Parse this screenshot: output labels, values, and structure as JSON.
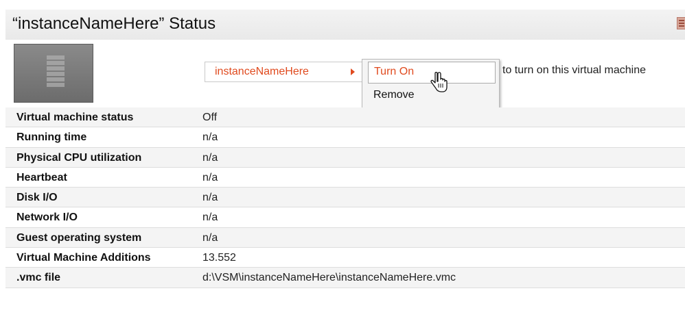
{
  "header": {
    "title": "“instanceNameHere” Status",
    "icon": "report-icon"
  },
  "vm": {
    "thumbnail_icon": "server-stack-icon",
    "menu_trigger_label": "instanceNameHere",
    "hint_text": "to turn on this virtual machine",
    "context_menu": {
      "items": [
        {
          "label": "Turn On"
        },
        {
          "label": "Remove"
        }
      ]
    }
  },
  "properties": [
    {
      "label": "Virtual machine status",
      "value": "Off"
    },
    {
      "label": "Running time",
      "value": "n/a"
    },
    {
      "label": "Physical CPU utilization",
      "value": "n/a"
    },
    {
      "label": "Heartbeat",
      "value": "n/a"
    },
    {
      "label": "Disk I/O",
      "value": "n/a"
    },
    {
      "label": "Network I/O",
      "value": "n/a"
    },
    {
      "label": "Guest operating system",
      "value": "n/a"
    },
    {
      "label": "Virtual Machine Additions",
      "value": "13.552"
    },
    {
      "label": ".vmc file",
      "value": "d:\\VSM\\instanceNameHere\\instanceNameHere.vmc"
    }
  ],
  "colors": {
    "accent": "#e04a1e",
    "row_alt": "#f4f4f4",
    "header_bg": "#eeeeee"
  }
}
